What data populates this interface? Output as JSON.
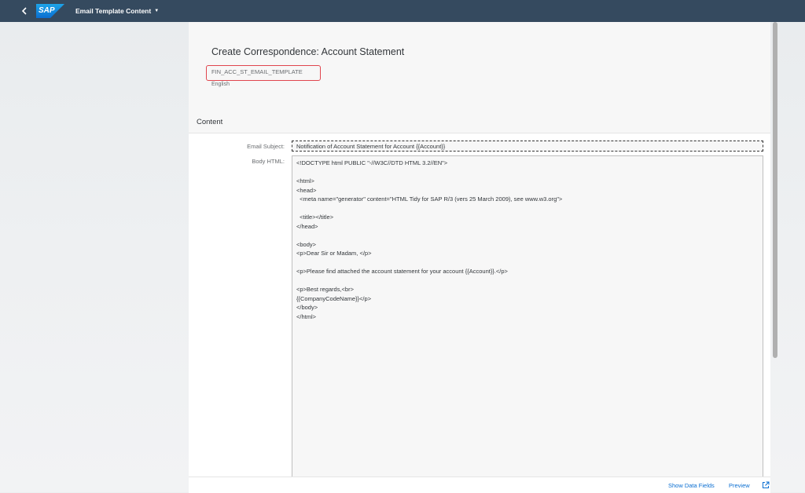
{
  "shell": {
    "logo_text": "SAP",
    "app_title": "Email Template Content",
    "colors": {
      "shell_bg": "#354a5f",
      "logo_blue": "#0a6ed1"
    }
  },
  "header": {
    "title": "Create Correspondence: Account Statement",
    "template_id": "FIN_ACC_ST_EMAIL_TEMPLATE",
    "language": "English"
  },
  "content": {
    "section_title": "Content",
    "subject_label": "Email Subject:",
    "subject_value": "Notification of Account Statement for Account {{Account}}",
    "body_label": "Body HTML:",
    "body_value": "<!DOCTYPE html PUBLIC \"-//W3C//DTD HTML 3.2//EN\">\n\n<html>\n<head>\n  <meta name=\"generator\" content=\"HTML Tidy for SAP R/3 (vers 25 March 2009), see www.w3.org\">\n\n  <title></title>\n</head>\n\n<body>\n<p>Dear Sir or Madam, </p>\n\n<p>Please find attached the account statement for your account {{Account}}.</p>\n\n<p>Best regards,<br>\n{{CompanyCodeName}}</p>\n</body>\n</html>"
  },
  "footer": {
    "show_data_fields": "Show Data Fields",
    "preview": "Preview",
    "open_icon": "external-link-icon"
  }
}
